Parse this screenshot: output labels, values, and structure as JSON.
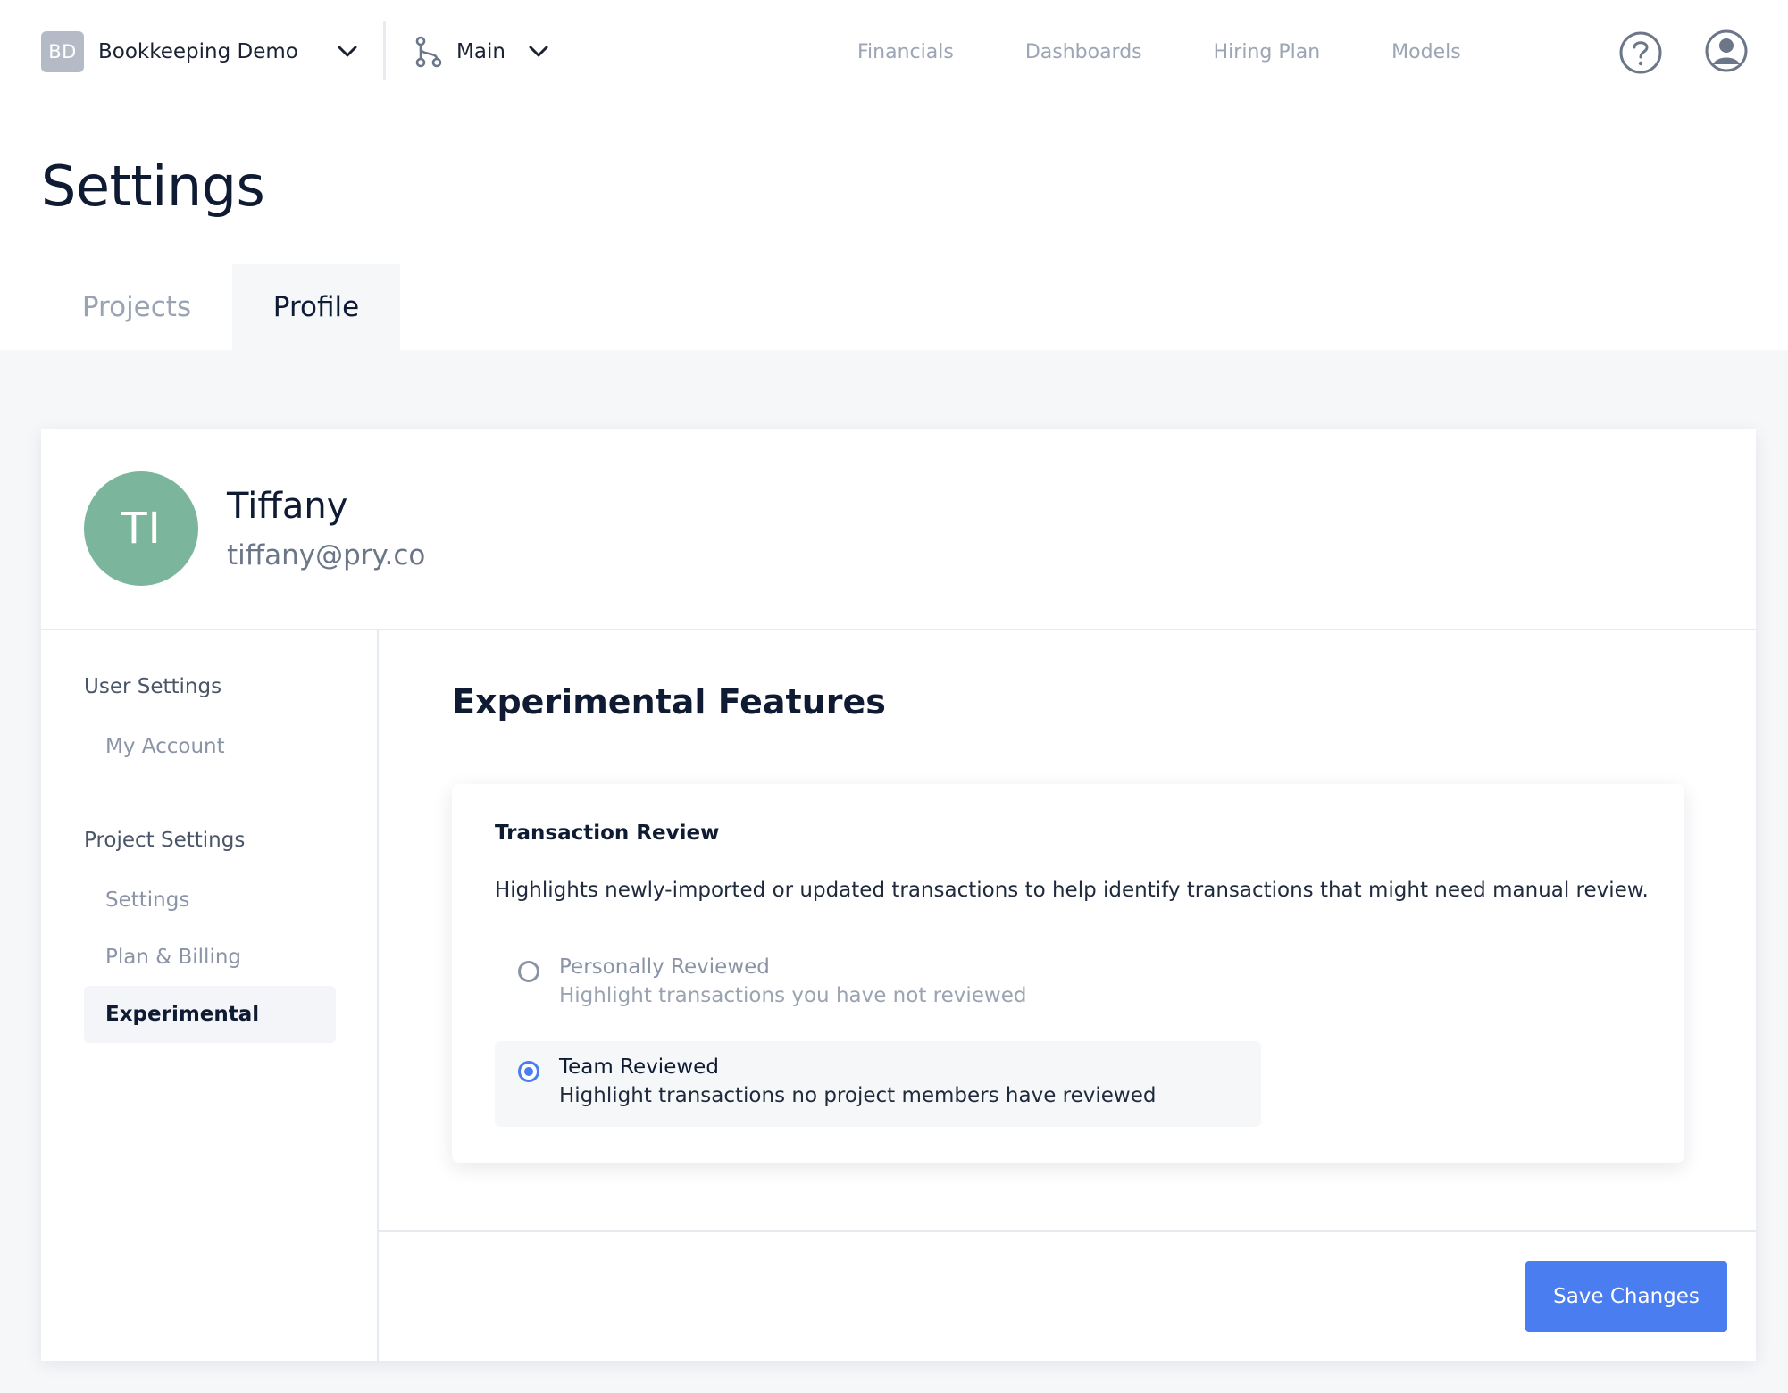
{
  "topbar": {
    "project_badge": "BD",
    "project_name": "Bookkeeping Demo",
    "branch_name": "Main",
    "nav": [
      "Financials",
      "Dashboards",
      "Hiring Plan",
      "Models"
    ],
    "icons": {
      "project_chevron": "chevron-down-icon",
      "branch": "git-branch-icon",
      "branch_chevron": "chevron-down-icon",
      "help": "help-circle-icon",
      "user": "user-circle-icon"
    }
  },
  "page": {
    "title": "Settings",
    "tabs": [
      {
        "label": "Projects",
        "active": false
      },
      {
        "label": "Profile",
        "active": true
      }
    ]
  },
  "profile": {
    "initials": "TI",
    "name": "Tiffany",
    "email": "tiffany@pry.co",
    "avatar_color": "#7bb59b"
  },
  "sidebar": {
    "groups": [
      {
        "label": "User Settings",
        "items": [
          {
            "label": "My Account",
            "active": false
          }
        ]
      },
      {
        "label": "Project Settings",
        "items": [
          {
            "label": "Settings",
            "active": false
          },
          {
            "label": "Plan & Billing",
            "active": false
          },
          {
            "label": "Experimental",
            "active": true
          }
        ]
      }
    ]
  },
  "main": {
    "section_title": "Experimental Features",
    "feature": {
      "title": "Transaction Review",
      "description": "Highlights newly-imported or updated transactions to help identify transactions that might need manual review.",
      "options": [
        {
          "label": "Personally Reviewed",
          "sub": "Highlight transactions you have not reviewed",
          "selected": false
        },
        {
          "label": "Team Reviewed",
          "sub": "Highlight transactions no project members have reviewed",
          "selected": true
        }
      ]
    },
    "save_label": "Save Changes"
  },
  "colors": {
    "accent": "#4a7df0",
    "background_gray": "#f5f7f9",
    "text_dark": "#0f1b33",
    "text_muted": "#9aa3b1"
  }
}
